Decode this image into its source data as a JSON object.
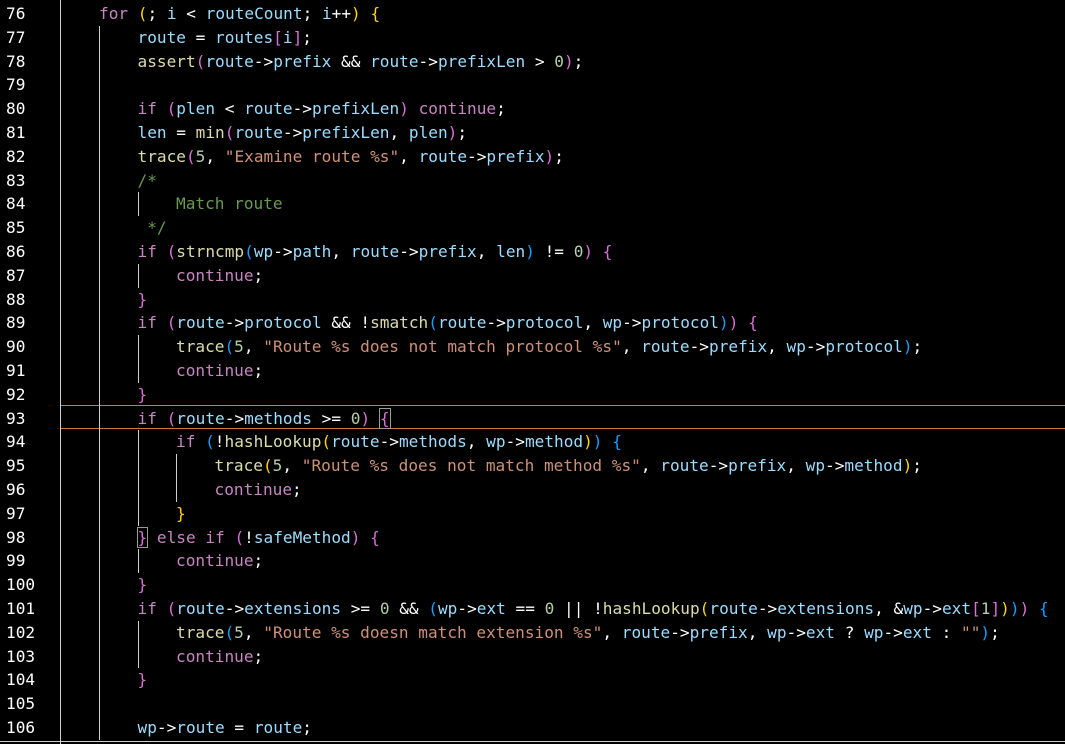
{
  "editor": {
    "colors": {
      "background": "#000000",
      "keyword": "#c586c0",
      "function": "#dcdcaa",
      "identifier": "#9cdcfe",
      "string": "#ce9178",
      "number": "#b5cea8",
      "comment": "#6a9955",
      "bracket_level_1": "#ffd700",
      "bracket_level_2": "#da70d6",
      "bracket_level_3": "#179fff",
      "current_line_border": "#c97a3e"
    },
    "current_line": "93",
    "lines": [
      {
        "number": "76",
        "indent": 0,
        "tokens": [
          [
            "kw",
            "for"
          ],
          [
            "plain",
            " "
          ],
          [
            "b1",
            "("
          ],
          [
            "plain",
            "; "
          ],
          [
            "id",
            "i"
          ],
          [
            "plain",
            " < "
          ],
          [
            "id",
            "routeCount"
          ],
          [
            "plain",
            "; "
          ],
          [
            "id",
            "i"
          ],
          [
            "plain",
            "++"
          ],
          [
            "b1",
            ")"
          ],
          [
            "plain",
            " "
          ],
          [
            "b1",
            "{"
          ]
        ]
      },
      {
        "number": "77",
        "indent": 1,
        "tokens": [
          [
            "id",
            "route"
          ],
          [
            "plain",
            " = "
          ],
          [
            "id",
            "routes"
          ],
          [
            "b2",
            "["
          ],
          [
            "id",
            "i"
          ],
          [
            "b2",
            "]"
          ],
          [
            "plain",
            ";"
          ]
        ]
      },
      {
        "number": "78",
        "indent": 1,
        "tokens": [
          [
            "fn",
            "assert"
          ],
          [
            "b2",
            "("
          ],
          [
            "id",
            "route"
          ],
          [
            "plain",
            "->"
          ],
          [
            "id",
            "prefix"
          ],
          [
            "plain",
            " && "
          ],
          [
            "id",
            "route"
          ],
          [
            "plain",
            "->"
          ],
          [
            "id",
            "prefixLen"
          ],
          [
            "plain",
            " > "
          ],
          [
            "num",
            "0"
          ],
          [
            "b2",
            ")"
          ],
          [
            "plain",
            ";"
          ]
        ]
      },
      {
        "number": "79",
        "indent": 1,
        "tokens": []
      },
      {
        "number": "80",
        "indent": 1,
        "tokens": [
          [
            "kw",
            "if"
          ],
          [
            "plain",
            " "
          ],
          [
            "b2",
            "("
          ],
          [
            "id",
            "plen"
          ],
          [
            "plain",
            " < "
          ],
          [
            "id",
            "route"
          ],
          [
            "plain",
            "->"
          ],
          [
            "id",
            "prefixLen"
          ],
          [
            "b2",
            ")"
          ],
          [
            "plain",
            " "
          ],
          [
            "kw",
            "continue"
          ],
          [
            "plain",
            ";"
          ]
        ]
      },
      {
        "number": "81",
        "indent": 1,
        "tokens": [
          [
            "id",
            "len"
          ],
          [
            "plain",
            " = "
          ],
          [
            "fn",
            "min"
          ],
          [
            "b2",
            "("
          ],
          [
            "id",
            "route"
          ],
          [
            "plain",
            "->"
          ],
          [
            "id",
            "prefixLen"
          ],
          [
            "plain",
            ", "
          ],
          [
            "id",
            "plen"
          ],
          [
            "b2",
            ")"
          ],
          [
            "plain",
            ";"
          ]
        ]
      },
      {
        "number": "82",
        "indent": 1,
        "tokens": [
          [
            "fn",
            "trace"
          ],
          [
            "b2",
            "("
          ],
          [
            "num",
            "5"
          ],
          [
            "plain",
            ", "
          ],
          [
            "str",
            "\"Examine route %s\""
          ],
          [
            "plain",
            ", "
          ],
          [
            "id",
            "route"
          ],
          [
            "plain",
            "->"
          ],
          [
            "id",
            "prefix"
          ],
          [
            "b2",
            ")"
          ],
          [
            "plain",
            ";"
          ]
        ]
      },
      {
        "number": "83",
        "indent": 1,
        "tokens": [
          [
            "cm",
            "/*"
          ]
        ]
      },
      {
        "number": "84",
        "indent": 2,
        "tokens": [
          [
            "cm",
            "Match route"
          ]
        ]
      },
      {
        "number": "85",
        "indent": 1,
        "tokens": [
          [
            "cm",
            " */"
          ]
        ]
      },
      {
        "number": "86",
        "indent": 1,
        "tokens": [
          [
            "kw",
            "if"
          ],
          [
            "plain",
            " "
          ],
          [
            "b2",
            "("
          ],
          [
            "fn",
            "strncmp"
          ],
          [
            "b3",
            "("
          ],
          [
            "id",
            "wp"
          ],
          [
            "plain",
            "->"
          ],
          [
            "id",
            "path"
          ],
          [
            "plain",
            ", "
          ],
          [
            "id",
            "route"
          ],
          [
            "plain",
            "->"
          ],
          [
            "id",
            "prefix"
          ],
          [
            "plain",
            ", "
          ],
          [
            "id",
            "len"
          ],
          [
            "b3",
            ")"
          ],
          [
            "plain",
            " != "
          ],
          [
            "num",
            "0"
          ],
          [
            "b2",
            ")"
          ],
          [
            "plain",
            " "
          ],
          [
            "b2",
            "{"
          ]
        ]
      },
      {
        "number": "87",
        "indent": 2,
        "tokens": [
          [
            "kw",
            "continue"
          ],
          [
            "plain",
            ";"
          ]
        ]
      },
      {
        "number": "88",
        "indent": 1,
        "tokens": [
          [
            "b2",
            "}"
          ]
        ]
      },
      {
        "number": "89",
        "indent": 1,
        "tokens": [
          [
            "kw",
            "if"
          ],
          [
            "plain",
            " "
          ],
          [
            "b2",
            "("
          ],
          [
            "id",
            "route"
          ],
          [
            "plain",
            "->"
          ],
          [
            "id",
            "protocol"
          ],
          [
            "plain",
            " && !"
          ],
          [
            "fn",
            "smatch"
          ],
          [
            "b3",
            "("
          ],
          [
            "id",
            "route"
          ],
          [
            "plain",
            "->"
          ],
          [
            "id",
            "protocol"
          ],
          [
            "plain",
            ", "
          ],
          [
            "id",
            "wp"
          ],
          [
            "plain",
            "->"
          ],
          [
            "id",
            "protocol"
          ],
          [
            "b3",
            ")"
          ],
          [
            "b2",
            ")"
          ],
          [
            "plain",
            " "
          ],
          [
            "b2",
            "{"
          ]
        ]
      },
      {
        "number": "90",
        "indent": 2,
        "tokens": [
          [
            "fn",
            "trace"
          ],
          [
            "b3",
            "("
          ],
          [
            "num",
            "5"
          ],
          [
            "plain",
            ", "
          ],
          [
            "str",
            "\"Route %s does not match protocol %s\""
          ],
          [
            "plain",
            ", "
          ],
          [
            "id",
            "route"
          ],
          [
            "plain",
            "->"
          ],
          [
            "id",
            "prefix"
          ],
          [
            "plain",
            ", "
          ],
          [
            "id",
            "wp"
          ],
          [
            "plain",
            "->"
          ],
          [
            "id",
            "protocol"
          ],
          [
            "b3",
            ")"
          ],
          [
            "plain",
            ";"
          ]
        ]
      },
      {
        "number": "91",
        "indent": 2,
        "tokens": [
          [
            "kw",
            "continue"
          ],
          [
            "plain",
            ";"
          ]
        ]
      },
      {
        "number": "92",
        "indent": 1,
        "tokens": [
          [
            "b2",
            "}"
          ]
        ]
      },
      {
        "number": "93",
        "indent": 1,
        "tokens": [
          [
            "kw",
            "if"
          ],
          [
            "plain",
            " "
          ],
          [
            "b2",
            "("
          ],
          [
            "id",
            "route"
          ],
          [
            "plain",
            "->"
          ],
          [
            "id",
            "methods"
          ],
          [
            "plain",
            " >= "
          ],
          [
            "num",
            "0"
          ],
          [
            "b2",
            ")"
          ],
          [
            "plain",
            " "
          ],
          [
            "b2x",
            "{"
          ]
        ]
      },
      {
        "number": "94",
        "indent": 2,
        "tokens": [
          [
            "kw",
            "if"
          ],
          [
            "plain",
            " "
          ],
          [
            "b3",
            "("
          ],
          [
            "plain",
            "!"
          ],
          [
            "fn",
            "hashLookup"
          ],
          [
            "b1",
            "("
          ],
          [
            "id",
            "route"
          ],
          [
            "plain",
            "->"
          ],
          [
            "id",
            "methods"
          ],
          [
            "plain",
            ", "
          ],
          [
            "id",
            "wp"
          ],
          [
            "plain",
            "->"
          ],
          [
            "id",
            "method"
          ],
          [
            "b1",
            ")"
          ],
          [
            "b3",
            ")"
          ],
          [
            "plain",
            " "
          ],
          [
            "b3",
            "{"
          ]
        ]
      },
      {
        "number": "95",
        "indent": 3,
        "tokens": [
          [
            "fn",
            "trace"
          ],
          [
            "b1",
            "("
          ],
          [
            "num",
            "5"
          ],
          [
            "plain",
            ", "
          ],
          [
            "str",
            "\"Route %s does not match method %s\""
          ],
          [
            "plain",
            ", "
          ],
          [
            "id",
            "route"
          ],
          [
            "plain",
            "->"
          ],
          [
            "id",
            "prefix"
          ],
          [
            "plain",
            ", "
          ],
          [
            "id",
            "wp"
          ],
          [
            "plain",
            "->"
          ],
          [
            "id",
            "method"
          ],
          [
            "b1",
            ")"
          ],
          [
            "plain",
            ";"
          ]
        ]
      },
      {
        "number": "96",
        "indent": 3,
        "tokens": [
          [
            "kw",
            "continue"
          ],
          [
            "plain",
            ";"
          ]
        ]
      },
      {
        "number": "97",
        "indent": 2,
        "tokens": [
          [
            "b1",
            "}"
          ]
        ]
      },
      {
        "number": "98",
        "indent": 1,
        "tokens": [
          [
            "b2x",
            "}"
          ],
          [
            "plain",
            " "
          ],
          [
            "kw",
            "else if"
          ],
          [
            "plain",
            " "
          ],
          [
            "b2",
            "("
          ],
          [
            "plain",
            "!"
          ],
          [
            "id",
            "safeMethod"
          ],
          [
            "b2",
            ")"
          ],
          [
            "plain",
            " "
          ],
          [
            "b2",
            "{"
          ]
        ]
      },
      {
        "number": "99",
        "indent": 2,
        "tokens": [
          [
            "kw",
            "continue"
          ],
          [
            "plain",
            ";"
          ]
        ]
      },
      {
        "number": "100",
        "indent": 1,
        "tokens": [
          [
            "b2",
            "}"
          ]
        ]
      },
      {
        "number": "101",
        "indent": 1,
        "tokens": [
          [
            "kw",
            "if"
          ],
          [
            "plain",
            " "
          ],
          [
            "b2",
            "("
          ],
          [
            "id",
            "route"
          ],
          [
            "plain",
            "->"
          ],
          [
            "id",
            "extensions"
          ],
          [
            "plain",
            " >= "
          ],
          [
            "num",
            "0"
          ],
          [
            "plain",
            " && "
          ],
          [
            "b3",
            "("
          ],
          [
            "id",
            "wp"
          ],
          [
            "plain",
            "->"
          ],
          [
            "id",
            "ext"
          ],
          [
            "plain",
            " == "
          ],
          [
            "num",
            "0"
          ],
          [
            "plain",
            " || !"
          ],
          [
            "fn",
            "hashLookup"
          ],
          [
            "b1",
            "("
          ],
          [
            "id",
            "route"
          ],
          [
            "plain",
            "->"
          ],
          [
            "id",
            "extensions"
          ],
          [
            "plain",
            ", &"
          ],
          [
            "id",
            "wp"
          ],
          [
            "plain",
            "->"
          ],
          [
            "id",
            "ext"
          ],
          [
            "b2",
            "["
          ],
          [
            "num",
            "1"
          ],
          [
            "b2",
            "]"
          ],
          [
            "b1",
            ")"
          ],
          [
            "b3",
            ")"
          ],
          [
            "b2",
            ")"
          ],
          [
            "plain",
            " "
          ],
          [
            "b3",
            "{"
          ]
        ]
      },
      {
        "number": "102",
        "indent": 2,
        "tokens": [
          [
            "fn",
            "trace"
          ],
          [
            "b3",
            "("
          ],
          [
            "num",
            "5"
          ],
          [
            "plain",
            ", "
          ],
          [
            "str",
            "\"Route %s doesn match extension %s\""
          ],
          [
            "plain",
            ", "
          ],
          [
            "id",
            "route"
          ],
          [
            "plain",
            "->"
          ],
          [
            "id",
            "prefix"
          ],
          [
            "plain",
            ", "
          ],
          [
            "id",
            "wp"
          ],
          [
            "plain",
            "->"
          ],
          [
            "id",
            "ext"
          ],
          [
            "plain",
            " ? "
          ],
          [
            "id",
            "wp"
          ],
          [
            "plain",
            "->"
          ],
          [
            "id",
            "ext"
          ],
          [
            "plain",
            " : "
          ],
          [
            "str",
            "\"\""
          ],
          [
            "b3",
            ")"
          ],
          [
            "plain",
            ";"
          ]
        ]
      },
      {
        "number": "103",
        "indent": 2,
        "tokens": [
          [
            "kw",
            "continue"
          ],
          [
            "plain",
            ";"
          ]
        ]
      },
      {
        "number": "104",
        "indent": 1,
        "tokens": [
          [
            "b2",
            "}"
          ]
        ]
      },
      {
        "number": "105",
        "indent": 1,
        "tokens": []
      },
      {
        "number": "106",
        "indent": 1,
        "tokens": [
          [
            "id",
            "wp"
          ],
          [
            "plain",
            "->"
          ],
          [
            "id",
            "route"
          ],
          [
            "plain",
            " = "
          ],
          [
            "id",
            "route"
          ],
          [
            "plain",
            ";"
          ]
        ]
      }
    ]
  }
}
